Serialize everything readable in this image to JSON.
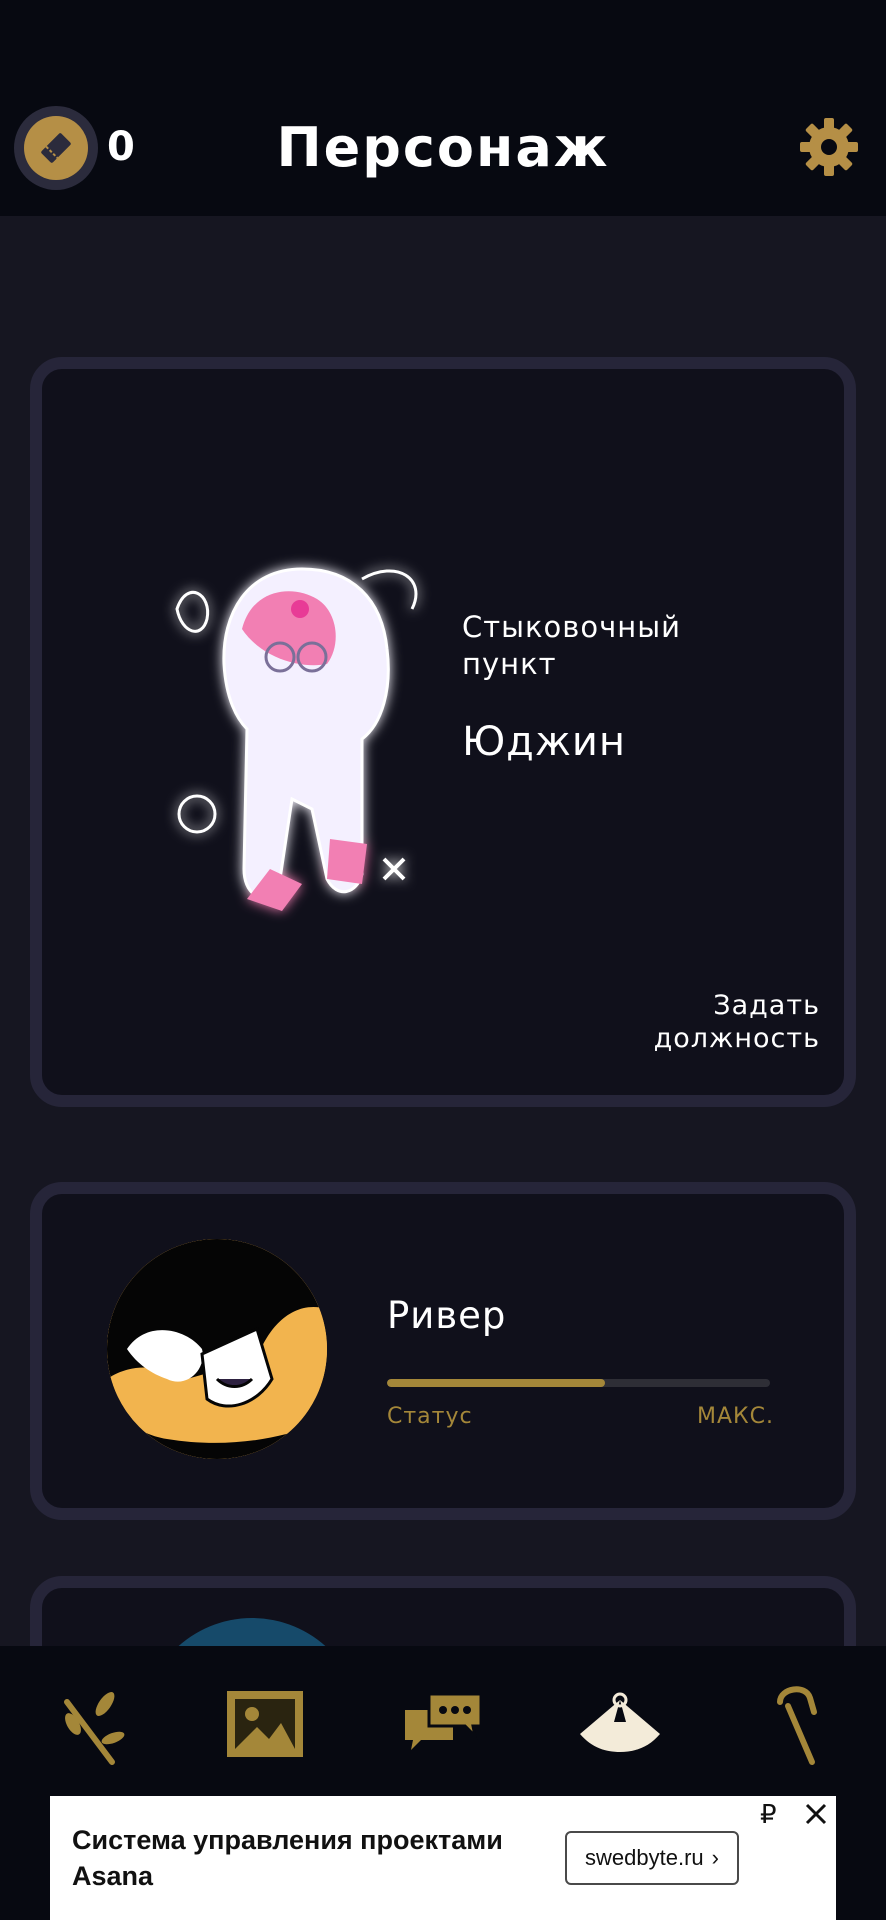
{
  "header": {
    "title": "Персонаж",
    "ticket_count": "0",
    "ticket_icon": "ticket-icon",
    "settings_icon": "gear-icon"
  },
  "featured_character": {
    "location": "Стыковочный пункт",
    "name": "Юджин",
    "assign_action": "Задать должность"
  },
  "characters": [
    {
      "name": "Ривер",
      "status_label": "Статус",
      "status_value": "МАКС.",
      "status_progress": 0.57
    }
  ],
  "bottom_nav": {
    "items": [
      {
        "icon": "branch-icon"
      },
      {
        "icon": "gallery-icon"
      },
      {
        "icon": "chat-icon"
      },
      {
        "icon": "tent-icon",
        "active": true
      },
      {
        "icon": "cane-icon"
      }
    ]
  },
  "ad": {
    "title": "Система управления проектами Asana",
    "cta": "swedbyte.ru",
    "currency": "₽"
  },
  "colors": {
    "background": "#161621",
    "header": "#070911",
    "accent_gold": "#b58f46",
    "card_border": "#262539",
    "card_bg": "#10101b"
  }
}
